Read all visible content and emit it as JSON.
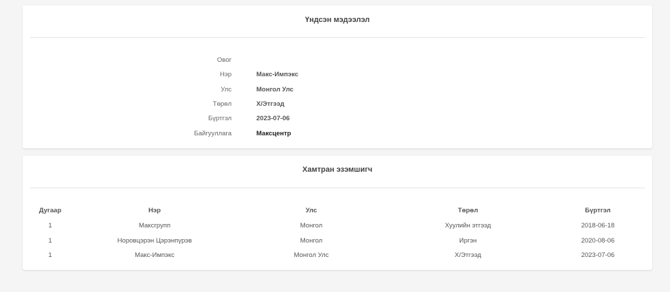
{
  "info_card": {
    "title": "Үндсэн мэдээлэл",
    "fields": [
      {
        "label": "Овог",
        "value": ""
      },
      {
        "label": "Нэр",
        "value": "Макс-Импэкс"
      },
      {
        "label": "Улс",
        "value": "Монгол Улс"
      },
      {
        "label": "Төрөл",
        "value": "Х/Этгээд"
      },
      {
        "label": "Бүртгэл",
        "value": "2023-07-06"
      },
      {
        "label": "Байгууллага",
        "value": "Максцентр"
      }
    ]
  },
  "owners_card": {
    "title": "Хамтран эзэмшигч",
    "columns": [
      "Дугаар",
      "Нэр",
      "Улс",
      "Төрөл",
      "Бүртгэл"
    ],
    "rows": [
      [
        "1",
        "Максгрупп",
        "Монгол",
        "Хуулийн этгээд",
        "2018-06-18"
      ],
      [
        "1",
        "Норовцэрэн Цэрэнпүрэв",
        "Монгол",
        "Иргэн",
        "2020-08-06"
      ],
      [
        "1",
        "Макс-Импэкс",
        "Монгол Улс",
        "Х/Этгээд",
        "2023-07-06"
      ]
    ]
  }
}
